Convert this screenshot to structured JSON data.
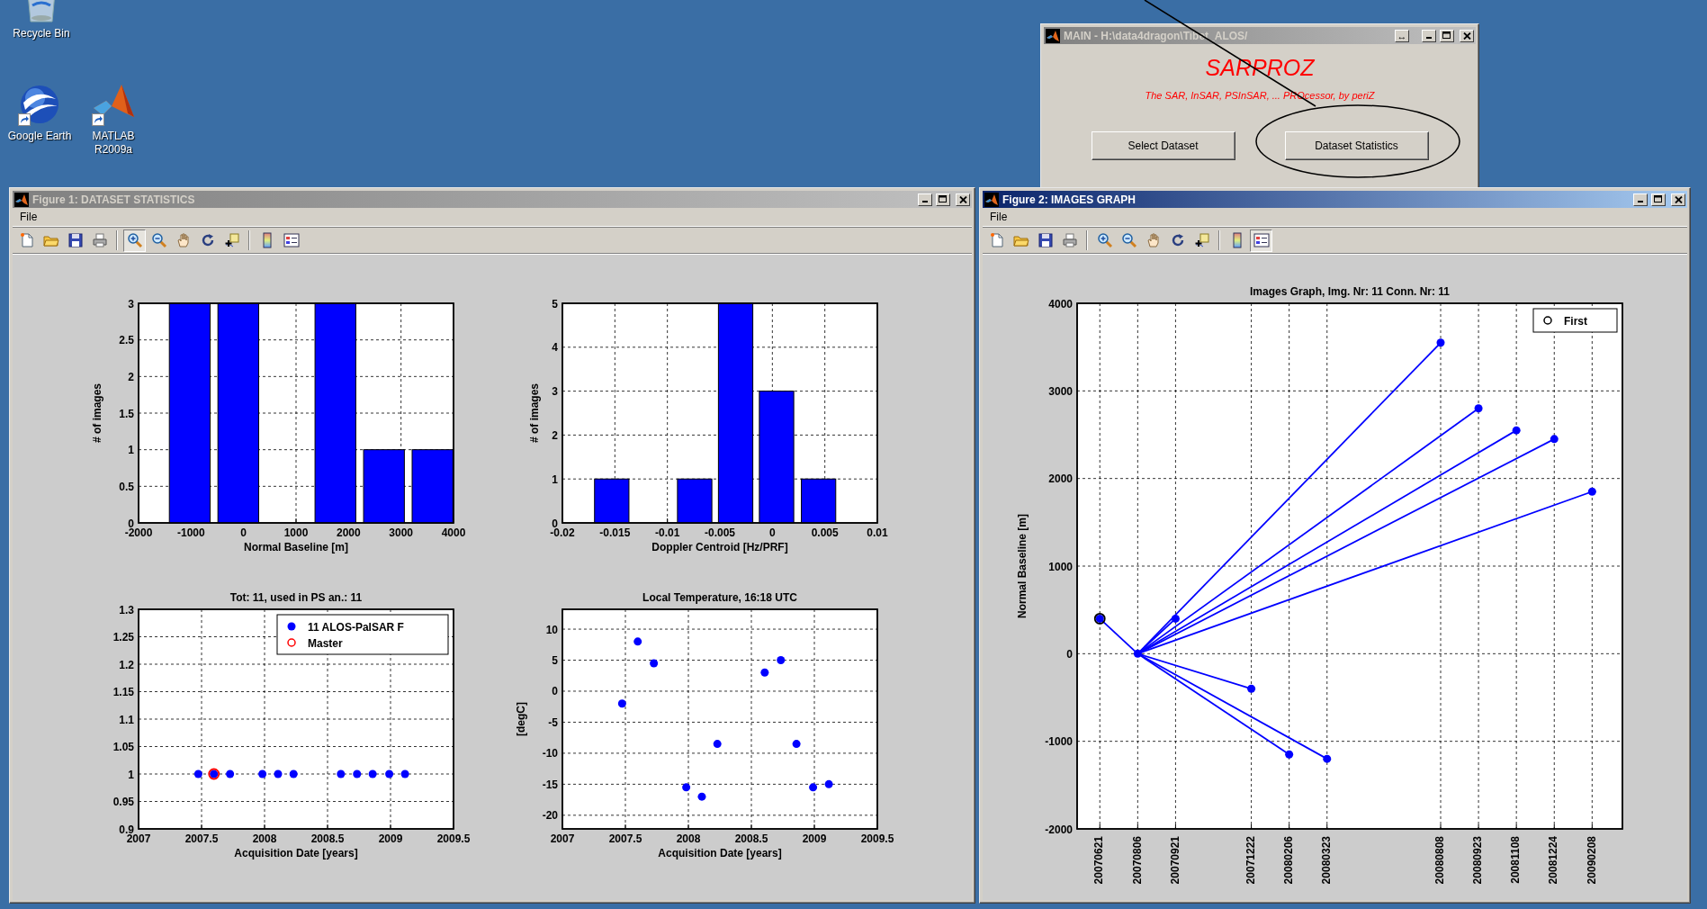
{
  "desktop_icons": [
    {
      "kind": "recycle_bin",
      "label": "Recycle Bin",
      "shortcut": false
    },
    {
      "kind": "globe",
      "label": "Google Earth",
      "shortcut": true
    },
    {
      "kind": "matlab",
      "label": "MATLAB R2009a",
      "shortcut": true
    }
  ],
  "main_window": {
    "title": "MAIN - H:\\data4dragon\\Tibet_ALOS/",
    "active": false,
    "undock_button": "↔",
    "app_name": "SARPROZ",
    "tagline": "The SAR, InSAR, PSInSAR, ... PROcessor, by periZ",
    "buttons": [
      "Select Dataset",
      "Dataset Statistics"
    ]
  },
  "figure_1": {
    "title": "Figure 1: DATASET STATISTICS",
    "active": false,
    "menu": [
      "File"
    ],
    "toolbar": [
      {
        "kind": "new",
        "pressed": false
      },
      {
        "kind": "open",
        "pressed": false
      },
      {
        "kind": "save",
        "pressed": false
      },
      {
        "kind": "print",
        "pressed": false
      },
      {
        "kind": "separator"
      },
      {
        "kind": "zoom_in",
        "pressed": true
      },
      {
        "kind": "zoom_out",
        "pressed": false
      },
      {
        "kind": "pan",
        "pressed": false
      },
      {
        "kind": "rotate_3d",
        "pressed": false
      },
      {
        "kind": "data_cursor",
        "pressed": false
      },
      {
        "kind": "separator"
      },
      {
        "kind": "colorbar",
        "pressed": false
      },
      {
        "kind": "legend",
        "pressed": false
      }
    ],
    "plots": [
      {
        "chart_data": {
          "type": "bar",
          "xlabel": "Normal Baseline [m]",
          "ylabel": "# of images",
          "x": [
            -1025,
            -100,
            1750,
            2675,
            3600
          ],
          "series": [
            {
              "color": "#0000ff",
              "values": [
                3,
                3,
                3,
                1,
                1
              ]
            }
          ],
          "xlim": [
            -2000,
            4000
          ],
          "ylim": [
            0,
            3
          ],
          "xticks": [
            -2000,
            -1000,
            0,
            1000,
            2000,
            3000,
            4000
          ],
          "yticks": [
            0,
            0.5,
            1,
            1.5,
            2,
            2.5,
            3
          ],
          "grid": true
        }
      },
      {
        "chart_data": {
          "type": "bar",
          "xlabel": "Doppler Centroid [Hz/PRF]",
          "ylabel": "# of images",
          "x": [
            -0.0153,
            -0.0074,
            -0.0035,
            0.0004,
            0.0044
          ],
          "series": [
            {
              "color": "#0000ff",
              "values": [
                1,
                1,
                5,
                3,
                1
              ]
            }
          ],
          "xlim": [
            -0.02,
            0.01
          ],
          "ylim": [
            0,
            5
          ],
          "xticks": [
            -0.02,
            -0.015,
            -0.01,
            -0.005,
            0,
            0.005,
            0.01
          ],
          "yticks": [
            0,
            1,
            2,
            3,
            4,
            5
          ],
          "grid": true
        }
      },
      {
        "chart_data": {
          "type": "scatter",
          "title": "Tot: 11, used in PS an.: 11",
          "xlabel": "Acquisition Date [years]",
          "x": [
            2007.474,
            2007.598,
            2007.726,
            2007.983,
            2008.107,
            2008.23,
            2008.606,
            2008.734,
            2008.858,
            2008.99,
            2009.115
          ],
          "series": [
            {
              "name": "11 ALOS-PalSAR F",
              "color": "#0000ff",
              "marker": "circle",
              "values": [
                1,
                1,
                1,
                1,
                1,
                1,
                1,
                1,
                1,
                1,
                1
              ]
            },
            {
              "name": "Master",
              "color": "#ff0000",
              "marker": "circle",
              "values": [
                null,
                1,
                null,
                null,
                null,
                null,
                null,
                null,
                null,
                null,
                null
              ]
            }
          ],
          "xlim": [
            2007,
            2009.5
          ],
          "ylim": [
            0.9,
            1.3
          ],
          "xticks": [
            2007,
            2007.5,
            2008,
            2008.5,
            2009,
            2009.5
          ],
          "yticks": [
            0.9,
            0.95,
            1,
            1.05,
            1.1,
            1.15,
            1.2,
            1.25,
            1.3
          ],
          "grid": true,
          "legend": true
        }
      },
      {
        "chart_data": {
          "type": "scatter",
          "title": "Local Temperature, 16:18 UTC",
          "xlabel": "Acquisition Date [years]",
          "ylabel": "[degC]",
          "x": [
            2007.474,
            2007.598,
            2007.726,
            2007.983,
            2008.107,
            2008.23,
            2008.606,
            2008.734,
            2008.858,
            2008.99,
            2009.115
          ],
          "series": [
            {
              "color": "#0000ff",
              "marker": "circle",
              "values": [
                -2,
                8,
                4.5,
                -15.5,
                -17,
                -8.5,
                3,
                5,
                -8.5,
                -15.5,
                -15
              ]
            }
          ],
          "xlim": [
            2007,
            2009.5
          ],
          "ylim": [
            -22.2,
            13.2
          ],
          "xticks": [
            2007,
            2007.5,
            2008,
            2008.5,
            2009,
            2009.5
          ],
          "yticks": [
            -20,
            -15,
            -10,
            -5,
            0,
            5,
            10
          ],
          "grid": true
        }
      }
    ]
  },
  "figure_2": {
    "title": "Figure 2: IMAGES GRAPH",
    "active": true,
    "menu": [
      "File"
    ],
    "toolbar": [
      {
        "kind": "new",
        "pressed": false
      },
      {
        "kind": "open",
        "pressed": false
      },
      {
        "kind": "save",
        "pressed": false
      },
      {
        "kind": "print",
        "pressed": false
      },
      {
        "kind": "separator"
      },
      {
        "kind": "zoom_in",
        "pressed": false
      },
      {
        "kind": "zoom_out",
        "pressed": false
      },
      {
        "kind": "pan",
        "pressed": false
      },
      {
        "kind": "rotate_3d",
        "pressed": false
      },
      {
        "kind": "data_cursor",
        "pressed": false
      },
      {
        "kind": "separator"
      },
      {
        "kind": "colorbar",
        "pressed": false
      },
      {
        "kind": "legend",
        "pressed": true
      }
    ],
    "plot": {
      "chart_data": {
        "type": "line",
        "title": "Images Graph, Img. Nr: 11 Conn. Nr: 11",
        "ylabel": "Normal Baseline [m]",
        "categories": [
          "20070621",
          "20070806",
          "20070921",
          null,
          "20071222",
          "20080206",
          "20080323",
          null,
          null,
          "20080808",
          "20080923",
          "20081108",
          "20081224",
          "20090208"
        ],
        "series": [
          {
            "color": "#0000ff",
            "marker": "circle",
            "values": [
              400,
              0,
              null,
              null,
              null,
              null,
              null,
              null,
              null,
              null,
              null,
              null,
              null,
              null
            ]
          },
          {
            "color": "#0000ff",
            "marker": "circle",
            "values": [
              null,
              0,
              400,
              null,
              null,
              null,
              null,
              null,
              null,
              null,
              null,
              null,
              null,
              null
            ]
          },
          {
            "color": "#0000ff",
            "marker": "circle",
            "values": [
              null,
              0,
              null,
              null,
              -400,
              null,
              null,
              null,
              null,
              null,
              null,
              null,
              null,
              null
            ]
          },
          {
            "color": "#0000ff",
            "marker": "circle",
            "values": [
              null,
              0,
              null,
              null,
              null,
              -1150,
              null,
              null,
              null,
              null,
              null,
              null,
              null,
              null
            ]
          },
          {
            "color": "#0000ff",
            "marker": "circle",
            "values": [
              null,
              0,
              null,
              null,
              null,
              null,
              -1200,
              null,
              null,
              null,
              null,
              null,
              null,
              null
            ]
          },
          {
            "color": "#0000ff",
            "marker": "circle",
            "values": [
              null,
              0,
              null,
              null,
              null,
              null,
              null,
              null,
              null,
              3550,
              null,
              null,
              null,
              null
            ]
          },
          {
            "color": "#0000ff",
            "marker": "circle",
            "values": [
              null,
              0,
              null,
              null,
              null,
              null,
              null,
              null,
              null,
              null,
              2800,
              null,
              null,
              null
            ]
          },
          {
            "color": "#0000ff",
            "marker": "circle",
            "values": [
              null,
              0,
              null,
              null,
              null,
              null,
              null,
              null,
              null,
              null,
              null,
              2550,
              null,
              null
            ]
          },
          {
            "color": "#0000ff",
            "marker": "circle",
            "values": [
              null,
              0,
              null,
              null,
              null,
              null,
              null,
              null,
              null,
              null,
              null,
              null,
              2450,
              null
            ]
          },
          {
            "color": "#0000ff",
            "marker": "circle",
            "values": [
              null,
              0,
              null,
              null,
              null,
              null,
              null,
              null,
              null,
              null,
              null,
              null,
              null,
              1850
            ]
          },
          {
            "name": "First",
            "color": "#000000",
            "marker": "circle",
            "values": [
              400,
              null,
              null,
              null,
              null,
              null,
              null,
              null,
              null,
              null,
              null,
              null,
              null,
              null
            ]
          }
        ],
        "ylim": [
          -2000,
          4000
        ],
        "yticks": [
          -2000,
          -1000,
          0,
          1000,
          2000,
          3000,
          4000
        ],
        "grid": true,
        "legend": true
      }
    }
  }
}
